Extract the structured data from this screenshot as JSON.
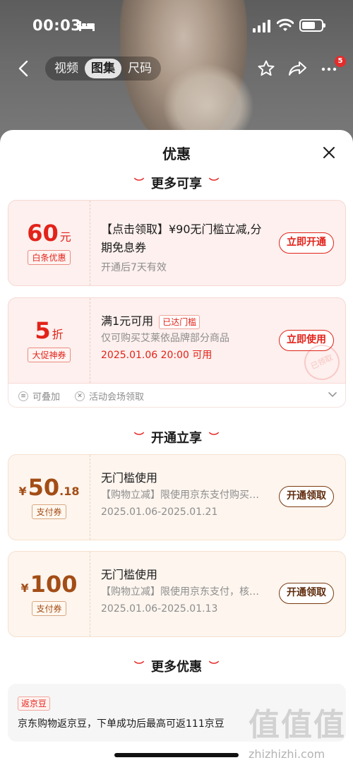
{
  "status_bar": {
    "time": "00:03"
  },
  "nav": {
    "tabs": [
      {
        "label": "视频"
      },
      {
        "label": "图集"
      },
      {
        "label": "尺码"
      }
    ],
    "more_badge": "5"
  },
  "sheet": {
    "title": "优惠",
    "sections": {
      "more_available": "更多可享",
      "open_enjoy": "开通立享",
      "more_offers": "更多优惠"
    },
    "coupons": [
      {
        "amount": "60",
        "unit": "元",
        "tag": "白条优惠",
        "title": "【点击领取】¥90无门槛立减,分期免息券",
        "sub": "开通后7天有效",
        "button": "立即开通"
      },
      {
        "amount": "5",
        "unit": "折",
        "tag": "大促神券",
        "title": "满1元可用",
        "badge": "已达门槛",
        "sub": "仅可购买艾莱依品牌部分商品",
        "date": "2025.01.06 20:00 可用",
        "button": "立即使用",
        "stamp": "已领取",
        "tips": [
          "可叠加",
          "活动会场领取"
        ]
      },
      {
        "yen": "¥",
        "amount": "50",
        "cents": ".18",
        "tag": "支付券",
        "title": "无门槛使用",
        "sub_bracket": "【购物立减】",
        "sub": "限使用京东支付购买…",
        "date": "2025.01.06-2025.01.21",
        "button": "开通领取"
      },
      {
        "yen": "¥",
        "amount": "100",
        "tag": "支付券",
        "title": "无门槛使用",
        "sub_bracket": "【购物立减】",
        "sub": "限使用京东支付，核…",
        "date": "2025.01.06-2025.01.13",
        "button": "开通领取"
      }
    ],
    "jd_bean": {
      "tag": "返京豆",
      "text": "京东购物返京豆，下单成功后最高可返111京豆"
    }
  },
  "watermark": {
    "glyphs": "值值值",
    "url": "zhizhizhi.com"
  },
  "colors": {
    "accent": "#e2231a",
    "gold": "#a34d16"
  }
}
